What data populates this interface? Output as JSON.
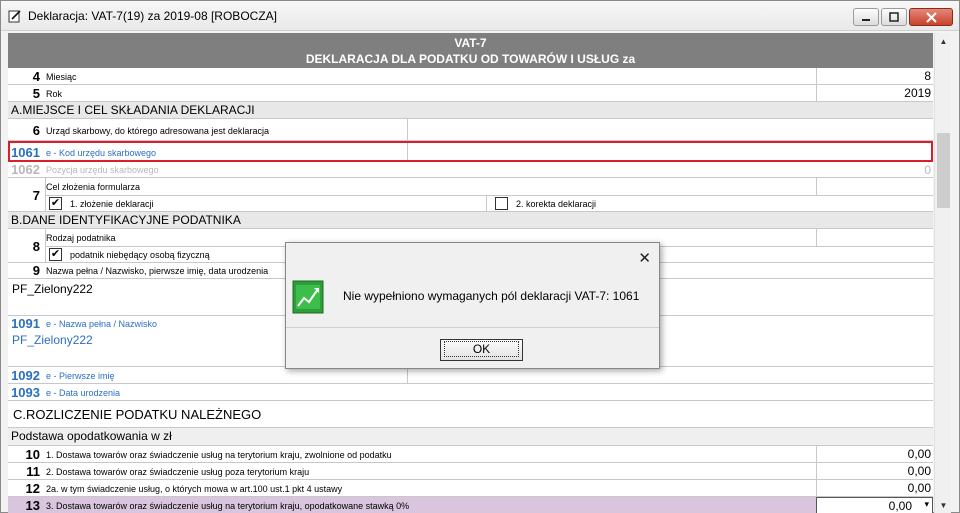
{
  "window": {
    "title": "Deklaracja: VAT-7(19) za 2019-08  [ROBOCZA]"
  },
  "form": {
    "header_line1": "VAT-7",
    "header_line2": "DEKLARACJA DLA PODATKU OD TOWARÓW I USŁUG za",
    "rows": {
      "r4": {
        "num": "4",
        "label": "Miesiąc",
        "value": "8"
      },
      "r5": {
        "num": "5",
        "label": "Rok",
        "value": "2019"
      },
      "secA": "A.MIEJSCE I CEL SKŁADANIA DEKLARACJI",
      "r6": {
        "num": "6",
        "label": "Urząd skarbowy, do którego adresowana jest deklaracja"
      },
      "r1061": {
        "num": "1061",
        "label": "e - Kod urzędu skarbowego"
      },
      "r1062": {
        "num": "1062",
        "label": "Pozycja urzędu skarbowego",
        "value": "0"
      },
      "r7": {
        "num": "7",
        "label": "Cel złożenia formularza",
        "opt1": "1. złożenie deklaracji",
        "opt2": "2. korekta deklaracji"
      },
      "secB": "B.DANE IDENTYFIKACYJNE PODATNIKA",
      "r8": {
        "num": "8",
        "label": "Rodzaj podatnika",
        "opt1": "podatnik niebędący osobą fizyczną"
      },
      "r9": {
        "num": "9",
        "label": "Nazwa pełna / Nazwisko, pierwsze imię, data urodzenia",
        "value": "PF_Zielony222"
      },
      "r1091": {
        "num": "1091",
        "label": "e - Nazwa pełna / Nazwisko",
        "value": "PF_Zielony222"
      },
      "r1092": {
        "num": "1092",
        "label": "e - Pierwsze imię"
      },
      "r1093": {
        "num": "1093",
        "label": "e - Data urodzenia"
      },
      "secC": "C.ROZLICZENIE PODATKU NALEŻNEGO",
      "subC": "Podstawa opodatkowania w zł",
      "r10": {
        "num": "10",
        "label": "1. Dostawa towarów oraz świadczenie usług na terytorium kraju, zwolnione od podatku",
        "value": "0,00"
      },
      "r11": {
        "num": "11",
        "label": "2. Dostawa towarów oraz świadczenie usług poza terytorium kraju",
        "value": "0,00"
      },
      "r12": {
        "num": "12",
        "label": "2a. w tym świadczenie usług, o których mowa w art.100 ust.1 pkt 4 ustawy",
        "value": "0,00"
      },
      "r13": {
        "num": "13",
        "label": "3. Dostawa towarów oraz świadczenie usług na terytorium kraju, opodatkowane stawką 0%",
        "value": "0,00"
      }
    }
  },
  "dialog": {
    "message": "Nie wypełniono wymaganych pól deklaracji VAT-7: 1061",
    "ok_label": "OK",
    "close_glyph": "✕"
  },
  "colors": {
    "highlight": "#d9202a",
    "blue_text": "#2b6fc2",
    "header_bg": "#7f7f7f",
    "row13_bg": "#d9c6de"
  }
}
